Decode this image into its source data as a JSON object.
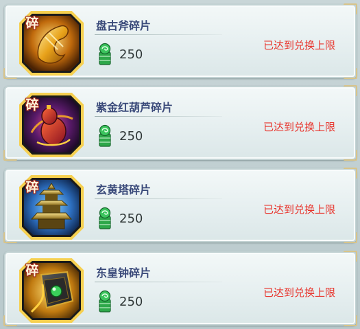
{
  "fragment_badge": "碎",
  "items": [
    {
      "name": "盘古斧碎片",
      "price": "250",
      "status": "已达到兑换上限",
      "icon": "pangu-axe-icon",
      "art_color": "#e8a21a"
    },
    {
      "name": "紫金红葫芦碎片",
      "price": "250",
      "status": "已达到兑换上限",
      "icon": "purple-gold-gourd-icon",
      "art_color": "#8a2c8c"
    },
    {
      "name": "玄黄塔碎片",
      "price": "250",
      "status": "已达到兑换上限",
      "icon": "xuanhuang-pagoda-icon",
      "art_color": "#2d6fc0"
    },
    {
      "name": "东皇钟碎片",
      "price": "250",
      "status": "已达到兑换上限",
      "icon": "donghuang-bell-icon",
      "art_color": "#3a9a2a"
    }
  ],
  "currency": {
    "icon": "jade-token-icon",
    "color": "#2ea84a"
  }
}
